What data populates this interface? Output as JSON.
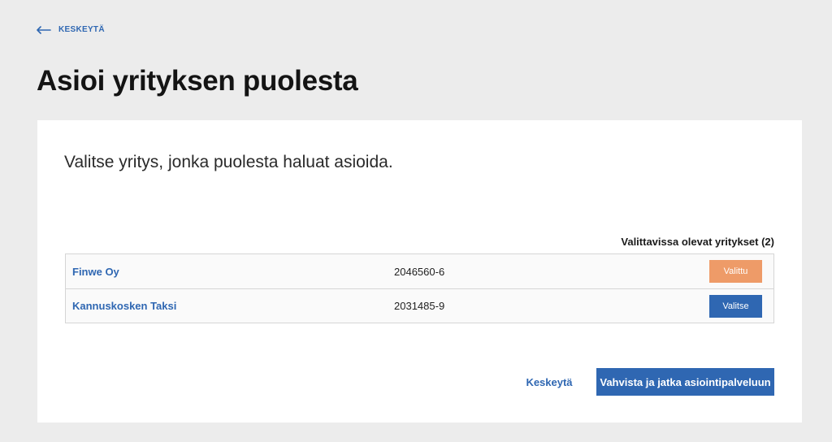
{
  "header": {
    "back_label": "KESKEYTÄ",
    "back_icon": "arrow-left-icon",
    "title": "Asioi yrityksen puolesta"
  },
  "card": {
    "instruction": "Valitse yritys, jonka puolesta haluat asioida.",
    "count_label": "Valittavissa olevat yritykset (2)",
    "companies": [
      {
        "name": "Finwe Oy",
        "business_id": "2046560-6",
        "button_label": "Valittu",
        "selected": true
      },
      {
        "name": "Kannuskosken Taksi",
        "business_id": "2031485-9",
        "button_label": "Valitse",
        "selected": false
      }
    ],
    "cancel_label": "Keskeytä",
    "confirm_label": "Vahvista ja jatka asiointipalveluun"
  },
  "colors": {
    "accent": "#2f67b2",
    "selected": "#ee9b68",
    "background": "#ececec"
  }
}
